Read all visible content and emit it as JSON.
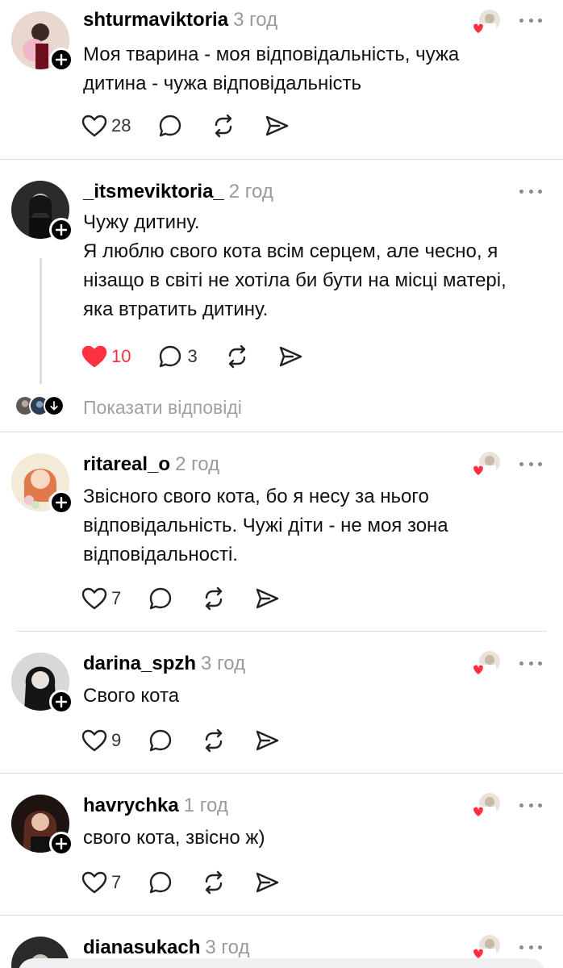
{
  "posts": [
    {
      "username": "shturmaviktoria",
      "age": "3 год",
      "text_lines": [
        "Моя тварина - моя відповідальність, чужа",
        "дитина - чужа відповідальність"
      ],
      "likes": "28",
      "replies": "",
      "liked": false
    },
    {
      "username": "_itsmeviktoria_",
      "age": "2 год",
      "text_lines": [
        "Чужу дитину.",
        "Я люблю свого кота всім серцем, але чесно, я",
        "нізащо в світі не хотіла би бути на місці матері,",
        "яка втратить дитину."
      ],
      "likes": "10",
      "replies": "3",
      "liked": true
    },
    {
      "username": "ritareal_o",
      "age": "2 год",
      "text_lines": [
        "Звісного свого кота, бо я несу за нього",
        "відповідальність. Чужі діти - не моя зона",
        "відповідальності."
      ],
      "likes": "7",
      "replies": "",
      "liked": false
    },
    {
      "username": "darina_spzh",
      "age": "3 год",
      "text_lines": [
        "Свого кота"
      ],
      "likes": "9",
      "replies": "",
      "liked": false
    },
    {
      "username": "havrychka",
      "age": "1 год",
      "text_lines": [
        "свого кота, звісно ж)"
      ],
      "likes": "7",
      "replies": "",
      "liked": false
    },
    {
      "username": "dianasukach",
      "age": "3 год",
      "text_lines": [],
      "likes": "",
      "replies": "",
      "liked": false
    }
  ],
  "show_replies_label": "Показати відповіді",
  "colors": {
    "like_red": "#ff3040",
    "muted_text": "#9a9a9a",
    "divider": "#dedede"
  },
  "icons": [
    "heart-icon",
    "comment-icon",
    "repost-icon",
    "share-icon",
    "more-icon",
    "follow-plus-icon",
    "arrow-down-icon"
  ]
}
